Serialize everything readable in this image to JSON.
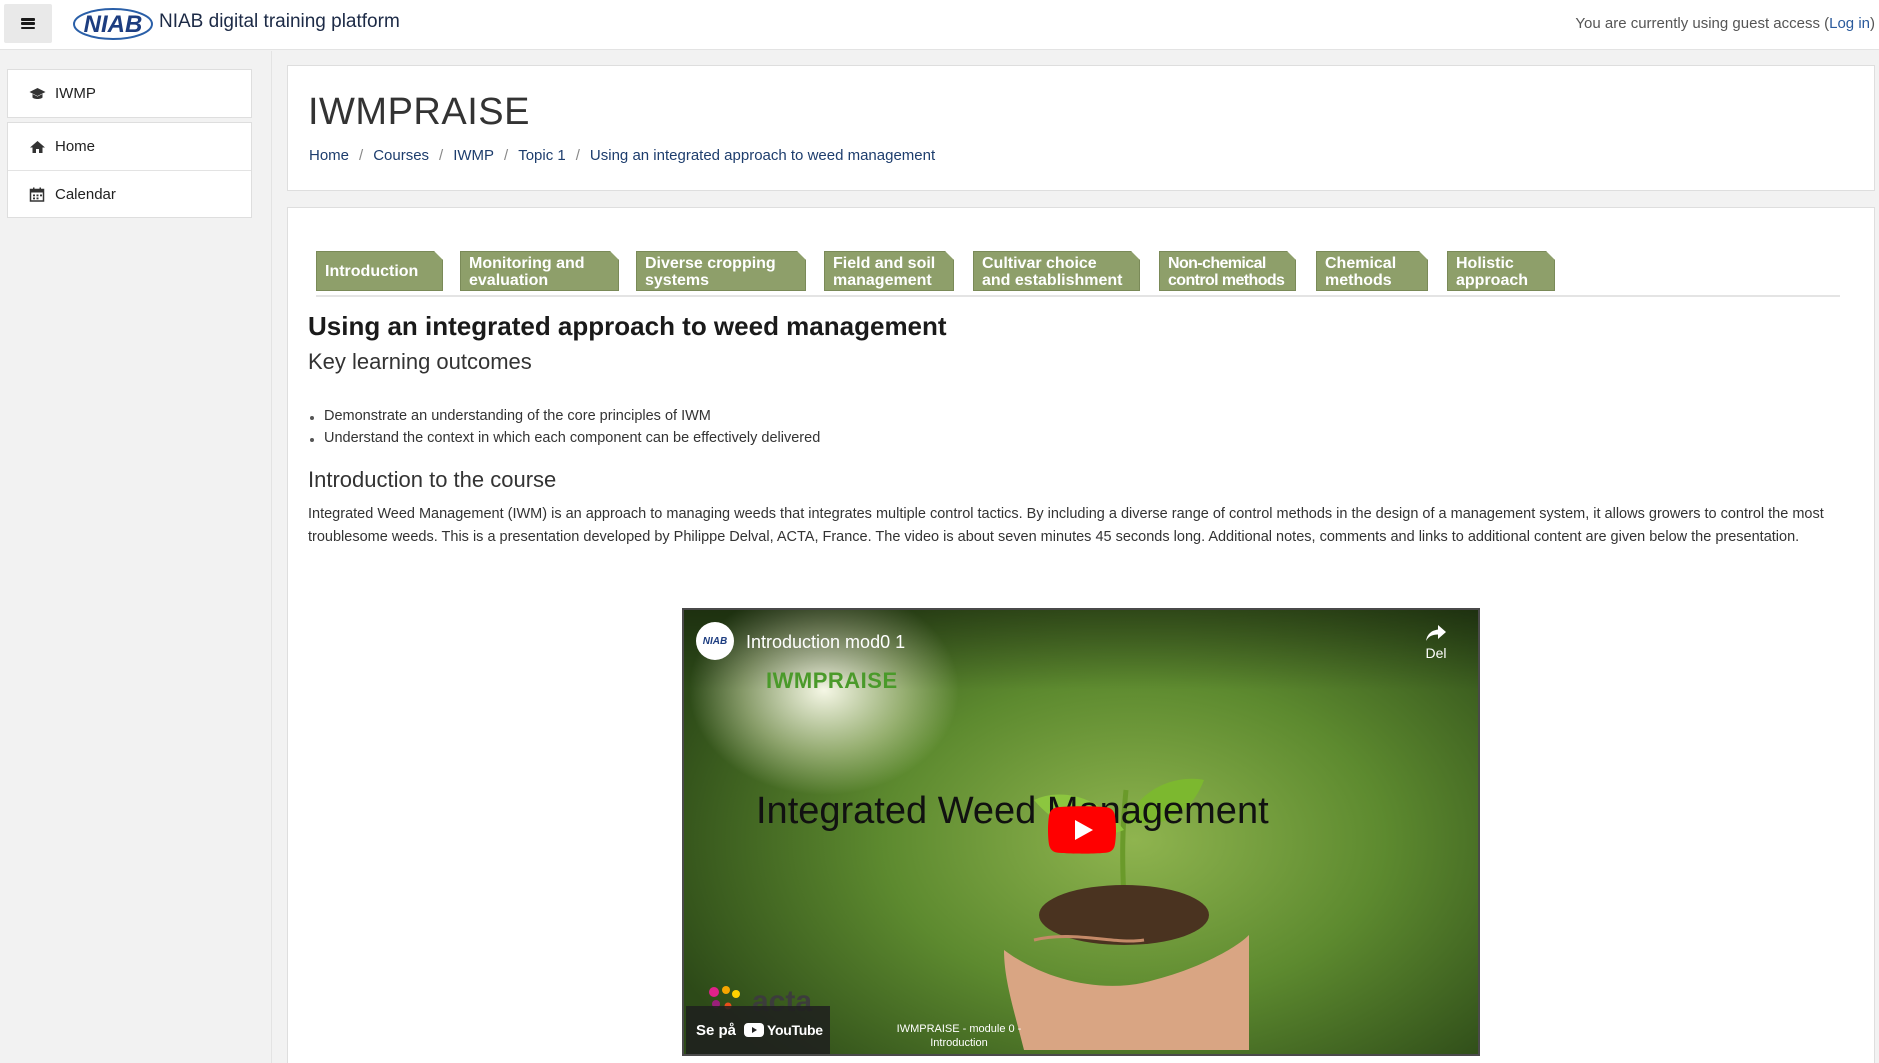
{
  "navbar": {
    "logo_text": "NIAB",
    "site_title": "NIAB digital training platform",
    "guest_prefix": "You are currently using guest access (",
    "login_label": "Log in",
    "guest_suffix": ")"
  },
  "drawer": {
    "course_item": "IWMP",
    "items": [
      {
        "label": "Home",
        "icon": "home-icon"
      },
      {
        "label": "Calendar",
        "icon": "calendar-icon"
      }
    ]
  },
  "header": {
    "course_title": "IWMPRAISE",
    "breadcrumb": [
      "Home",
      "Courses",
      "IWMP",
      "Topic 1",
      "Using an integrated approach to weed management"
    ]
  },
  "tabs": [
    {
      "line1": "Introduction",
      "line2": ""
    },
    {
      "line1": "Monitoring and",
      "line2": "evaluation"
    },
    {
      "line1": "Diverse cropping",
      "line2": "systems"
    },
    {
      "line1": "Field and soil",
      "line2": "management"
    },
    {
      "line1": "Cultivar choice",
      "line2": "and establishment"
    },
    {
      "line1": "Non-chemical",
      "line2": "control methods"
    },
    {
      "line1": "Chemical",
      "line2": "methods"
    },
    {
      "line1": "Holistic",
      "line2": "approach"
    }
  ],
  "content": {
    "heading": "Using an integrated approach to weed management",
    "outcomes_heading": "Key learning outcomes",
    "outcomes": [
      "Demonstrate an understanding of the core principles of IWM",
      "Understand the context in which each component can be effectively delivered"
    ],
    "intro_heading": "Introduction to the course",
    "intro_text": "Integrated Weed Management (IWM) is an approach to managing weeds that integrates multiple control tactics. By including a diverse range of control methods in the design of a management system, it allows growers to control the most troublesome weeds. This is a presentation developed by Philippe Delval, ACTA, France. The video is about seven minutes 45 seconds long. Additional notes, comments and links to additional content are given below the presentation."
  },
  "video": {
    "channel_avatar_text": "NIAB",
    "title": "Introduction mod0 1",
    "share_label": "Del",
    "logo_text": "IWMPRAISE",
    "headline": "Integrated Weed Management",
    "watch_on": "Se på",
    "youtube_word": "YouTube",
    "caption_line1": "IWMPRAISE - module 0 -",
    "caption_line2": "Introduction",
    "acta_text": "acta"
  },
  "colors": {
    "tab_bg": "#8e9f6a",
    "link": "#1d3d6d",
    "youtube_red": "#ff0000"
  }
}
